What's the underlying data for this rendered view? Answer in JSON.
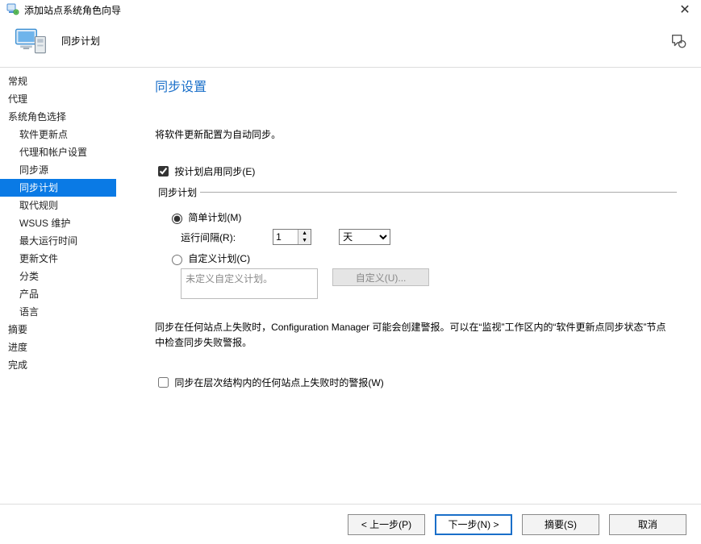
{
  "window": {
    "title": "添加站点系统角色向导",
    "close_glyph": "✕"
  },
  "banner": {
    "title": "同步计划"
  },
  "sidebar": {
    "items": [
      {
        "label": "常规",
        "level": 1
      },
      {
        "label": "代理",
        "level": 1
      },
      {
        "label": "系统角色选择",
        "level": 1
      },
      {
        "label": "软件更新点",
        "level": 2
      },
      {
        "label": "代理和帐户设置",
        "level": 2
      },
      {
        "label": "同步源",
        "level": 2
      },
      {
        "label": "同步计划",
        "level": 2,
        "selected": true
      },
      {
        "label": "取代规则",
        "level": 2
      },
      {
        "label": "WSUS 维护",
        "level": 2
      },
      {
        "label": "最大运行时间",
        "level": 2
      },
      {
        "label": "更新文件",
        "level": 2
      },
      {
        "label": "分类",
        "level": 2
      },
      {
        "label": "产品",
        "level": 2
      },
      {
        "label": "语言",
        "level": 2
      },
      {
        "label": "摘要",
        "level": 1
      },
      {
        "label": "进度",
        "level": 1
      },
      {
        "label": "完成",
        "level": 1
      }
    ]
  },
  "content": {
    "heading": "同步设置",
    "description": "将软件更新配置为自动同步。",
    "enable_schedule_label": "按计划启用同步(E)",
    "enable_schedule_checked": true,
    "schedule_legend": "同步计划",
    "simple_label": "简单计划(M)",
    "custom_label": "自定义计划(C)",
    "selected_radio": "simple",
    "interval_label": "运行间隔(R):",
    "interval_value": "1",
    "interval_unit": "天",
    "custom_placeholder": "未定义自定义计划。",
    "custom_button": "自定义(U)...",
    "note_text": "同步在任何站点上失败时，Configuration Manager 可能会创建警报。可以在“监视”工作区内的“软件更新点同步状态”节点中检查同步失败警报。",
    "alert_checkbox_label": "同步在层次结构内的任何站点上失败时的警报(W)",
    "alert_checked": false
  },
  "footer": {
    "prev": "< 上一步(P)",
    "next": "下一步(N) >",
    "summary": "摘要(S)",
    "cancel": "取消"
  }
}
